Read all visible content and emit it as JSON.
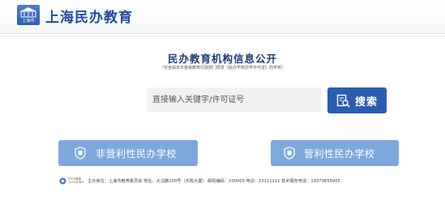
{
  "header": {
    "site_title": "上海民办教育",
    "logo_small_text": "上海市",
    "logo_icon": "building-emblem-icon"
  },
  "main": {
    "title": "民办教育机构信息公开",
    "subtitle": "（仅含由本市各级教育行政部门颁发《民办学校办学许可证》的学校）"
  },
  "search": {
    "placeholder": "直接输入关键字/许可证号",
    "button_label": "搜索",
    "button_icon": "document-search-icon"
  },
  "categories": [
    {
      "label": "非营利性民办学校",
      "icon": "shield-document-icon"
    },
    {
      "label": "营利性民办学校",
      "icon": "shield-document-icon"
    }
  ],
  "footer": {
    "badge_line1": "沪ICP备案",
    "badge_line2": "1234SHNH",
    "info": "主办单位：上海市教育委员会 地址：大沽路100号（市政大厦） 邮政编码：200003 电话：23111111 技术服务电话：19370655905"
  },
  "colors": {
    "brand_blue": "#2b5db2",
    "category_blue": "#7ea8dc",
    "title_blue": "#1d3b78"
  }
}
